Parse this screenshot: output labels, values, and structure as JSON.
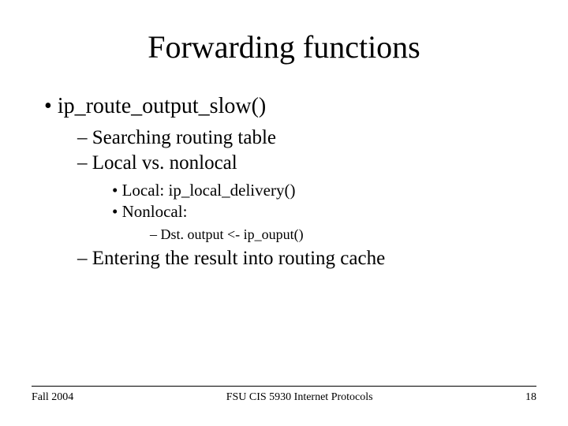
{
  "title": "Forwarding functions",
  "bullets": {
    "item1": "ip_route_output_slow()",
    "sub1": "Searching routing table",
    "sub2": "Local vs. nonlocal",
    "subsub1": "Local: ip_local_delivery()",
    "subsub2": "Nonlocal:",
    "subsubsub1": "Dst. output <- ip_ouput()",
    "sub3": "Entering the result into routing cache"
  },
  "footer": {
    "left": "Fall 2004",
    "center": "FSU CIS 5930 Internet Protocols",
    "right": "18"
  }
}
